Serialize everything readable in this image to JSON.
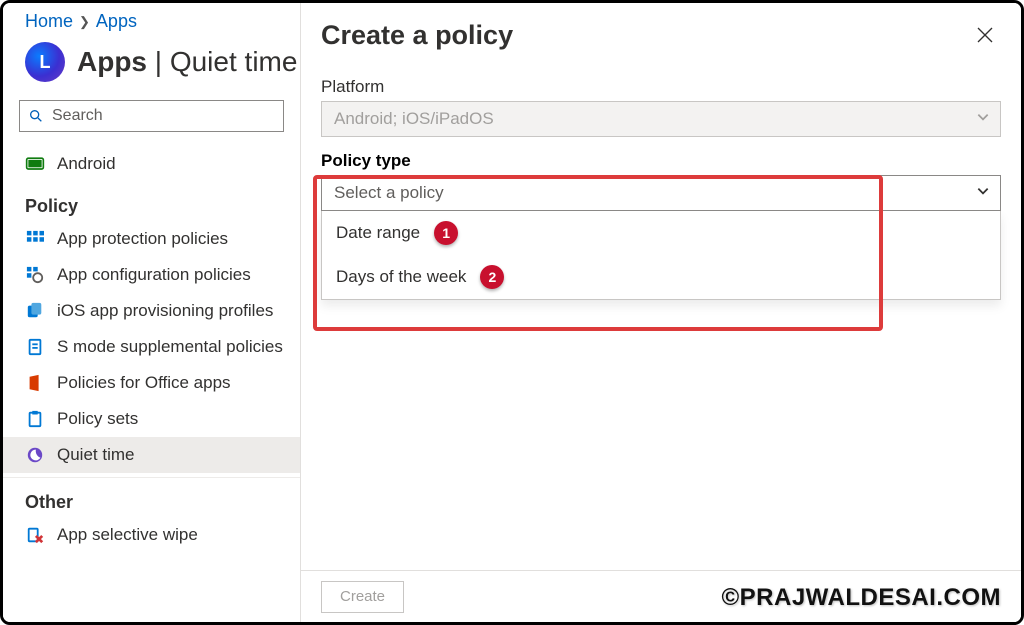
{
  "breadcrumb": {
    "home": "Home",
    "apps": "Apps"
  },
  "page_title": {
    "strong": "Apps",
    "suffix": " | Quiet time"
  },
  "search": {
    "placeholder": "Search"
  },
  "nav": {
    "android": "Android",
    "group_policy": "Policy",
    "app_protection": "App protection policies",
    "app_config": "App configuration policies",
    "ios_prov": "iOS app provisioning profiles",
    "s_mode": "S mode supplemental policies",
    "office": "Policies for Office apps",
    "policy_sets": "Policy sets",
    "quiet_time": "Quiet time",
    "group_other": "Other",
    "app_selective": "App selective wipe"
  },
  "panel": {
    "title": "Create a policy",
    "platform_label": "Platform",
    "platform_value": "Android; iOS/iPadOS",
    "policy_type_label": "Policy type",
    "policy_type_placeholder": "Select a policy",
    "options": {
      "date_range": "Date range",
      "days_of_week": "Days of the week"
    },
    "badges": {
      "one": "1",
      "two": "2"
    },
    "create": "Create"
  },
  "watermark": "©PRAJWALDESAI.COM"
}
